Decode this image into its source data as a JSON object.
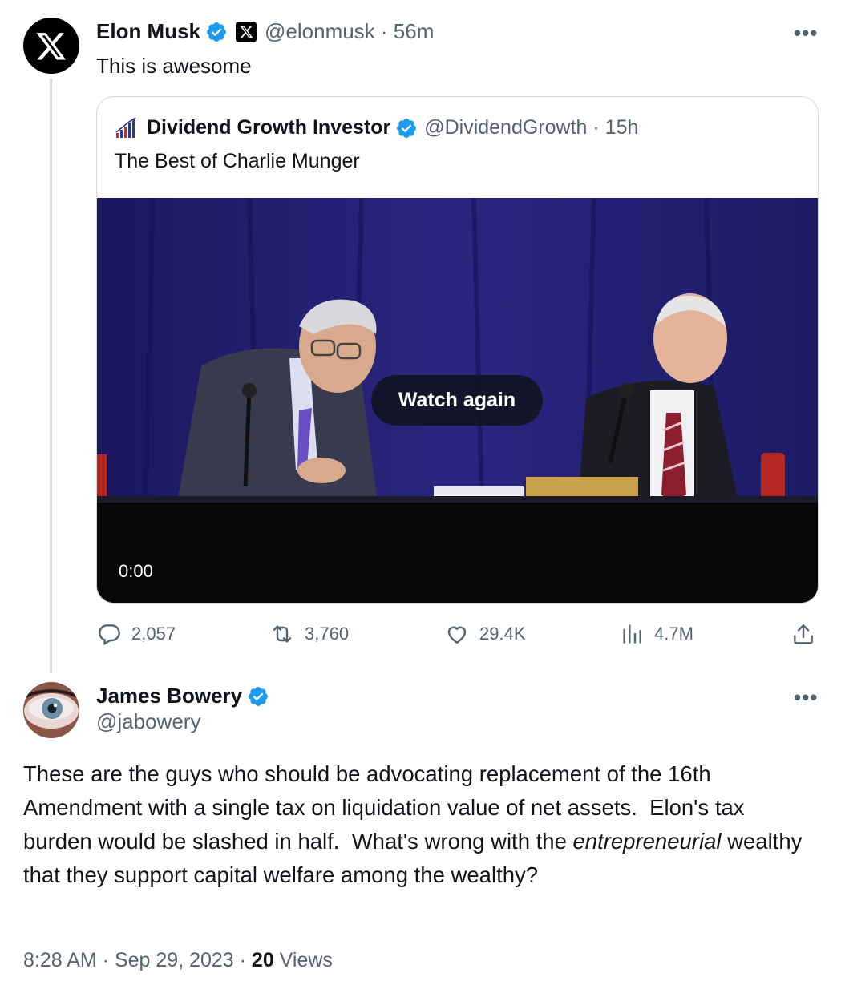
{
  "main_tweet": {
    "author_name": "Elon Musk",
    "handle": "@elonmusk",
    "separator": " · ",
    "time": "56m",
    "text": "This is awesome",
    "more_label": "•••"
  },
  "quoted_tweet": {
    "author_name": "Dividend Growth Investor",
    "handle": "@DividendGrowth",
    "separator": " · ",
    "time": "15h",
    "text": "The Best of Charlie Munger",
    "video": {
      "overlay_button": "Watch again",
      "timestamp": "0:00"
    }
  },
  "actions": {
    "replies": "2,057",
    "reposts": "3,760",
    "likes": "29.4K",
    "views": "4.7M"
  },
  "reply_tweet": {
    "author_name": "James Bowery",
    "handle": "@jabowery",
    "more_label": "•••",
    "text_part1": "These are the guys who should be advocating replacement of the 16th Amendment with a single tax on liquidation value of net assets.  Elon's tax burden would be slashed in half.  What's wrong with the ",
    "text_emphasis": "entrepreneurial",
    "text_part2": " wealthy that they support capital welfare among the wealthy?",
    "time": "8:28 AM",
    "date": "Sep 29, 2023",
    "sep1": " · ",
    "sep2": " · ",
    "views_count": "20",
    "views_label": " Views"
  },
  "colors": {
    "verified_blue": "#1d9bf0",
    "secondary_text": "#536471",
    "border": "#cfd9de",
    "video_stage_blue": "#231f6e"
  }
}
